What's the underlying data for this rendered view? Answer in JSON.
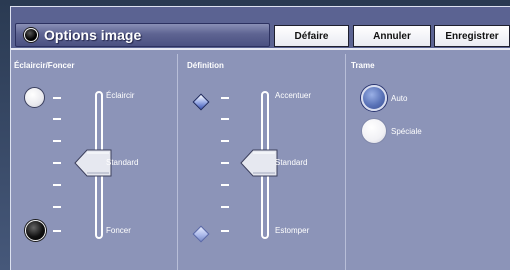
{
  "header": {
    "title": "Options image",
    "buttons": {
      "undo": "Défaire",
      "cancel": "Annuler",
      "save": "Enregistrer"
    }
  },
  "panels": {
    "lighten": {
      "title": "Éclaircir/Foncer",
      "top_label": "Éclaircir",
      "middle_label": "Standard",
      "bottom_label": "Foncer"
    },
    "definition": {
      "title": "Définition",
      "top_label": "Accentuer",
      "middle_label": "Standard",
      "bottom_label": "Estomper"
    },
    "screen": {
      "title": "Trame",
      "options": [
        "Auto",
        "Spéciale"
      ],
      "selected": "Auto"
    }
  },
  "colors": {
    "background": "#8c94b8",
    "header": "#5b6392",
    "selected_radio": "#5a73b8"
  },
  "icons": {
    "title": "black-circle-icon",
    "light": "white-circle-icon",
    "dark": "black-circle-icon",
    "sharpen": "diamond-icon",
    "soften": "diamond-icon",
    "slider_thumb": "arrow-thumb-icon"
  }
}
